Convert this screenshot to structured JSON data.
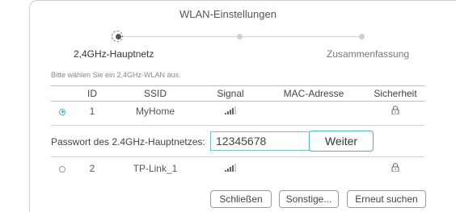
{
  "dialog": {
    "title": "WLAN-Einstellungen"
  },
  "steps": [
    {
      "label": "2,4GHz-Hauptnetz",
      "active": true
    },
    {
      "label": "",
      "active": false
    },
    {
      "label": "Zusammenfassung",
      "active": false
    }
  ],
  "hint": "Bitte wählen Sie ein 2,4GHz-WLAN aus.",
  "table": {
    "columns": [
      "ID",
      "SSID",
      "Signal",
      "MAC-Adresse",
      "Sicherheit"
    ],
    "rows": [
      {
        "id": "1",
        "ssid": "MyHome",
        "signal_icon": "signal-bars-icon",
        "mac": "",
        "security_icon": "lock-icon",
        "selected": true
      },
      {
        "id": "2",
        "ssid": "TP-Link_1",
        "signal_icon": "signal-bars-icon",
        "mac": "",
        "security_icon": "lock-icon",
        "selected": false
      }
    ]
  },
  "password": {
    "label": "Passwort des 2.4GHz-Hauptnetzes:",
    "value": "12345678",
    "button": "Weiter"
  },
  "footer": {
    "close": "Schließen",
    "other": "Sonstige...",
    "rescan": "Erneut suchen"
  },
  "colors": {
    "accent": "#4bb5b9"
  }
}
